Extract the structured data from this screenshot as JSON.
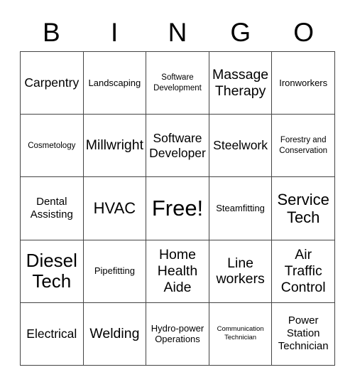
{
  "card": {
    "title": "BINGO",
    "header_letters": [
      "B",
      "I",
      "N",
      "G",
      "O"
    ],
    "grid_size": "5x5",
    "free_space_label": "Free!",
    "border_color": "#444444",
    "text_color": "#000000",
    "background_color": "#ffffff"
  },
  "grid": {
    "columns": [
      "B",
      "I",
      "N",
      "G",
      "O"
    ],
    "rows": [
      [
        {
          "text": "Carpentry",
          "size": "l"
        },
        {
          "text": "Landscaping",
          "size": "s"
        },
        {
          "text": "Software Development",
          "size": "xs"
        },
        {
          "text": "Massage Therapy",
          "size": "xl"
        },
        {
          "text": "Ironworkers",
          "size": "s"
        }
      ],
      [
        {
          "text": "Cosmetology",
          "size": "xs"
        },
        {
          "text": "Millwright",
          "size": "xl"
        },
        {
          "text": "Software Developer",
          "size": "l"
        },
        {
          "text": "Steelwork",
          "size": "l"
        },
        {
          "text": "Forestry and Conservation",
          "size": "xs"
        }
      ],
      [
        {
          "text": "Dental Assisting",
          "size": "m"
        },
        {
          "text": "HVAC",
          "size": "2xl"
        },
        {
          "text": "Free!",
          "size": "4xl"
        },
        {
          "text": "Steamfitting",
          "size": "s"
        },
        {
          "text": "Service Tech",
          "size": "2xl"
        }
      ],
      [
        {
          "text": "Diesel Tech",
          "size": "3xl"
        },
        {
          "text": "Pipefitting",
          "size": "s"
        },
        {
          "text": "Home Health Aide",
          "size": "xl"
        },
        {
          "text": "Line workers",
          "size": "xl"
        },
        {
          "text": "Air Traffic Control",
          "size": "xl"
        }
      ],
      [
        {
          "text": "Electrical",
          "size": "l"
        },
        {
          "text": "Welding",
          "size": "xl"
        },
        {
          "text": "Hydro-power Operations",
          "size": "s"
        },
        {
          "text": "Communication Technician",
          "size": "xxs"
        },
        {
          "text": "Power Station Technician",
          "size": "m"
        }
      ]
    ]
  }
}
